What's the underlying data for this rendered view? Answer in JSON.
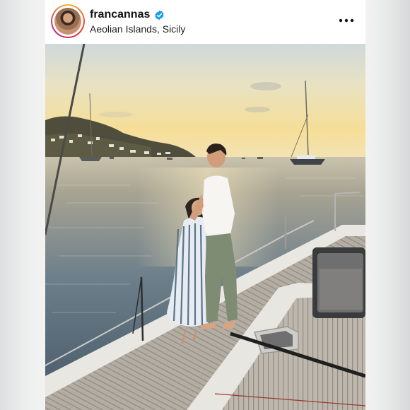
{
  "post": {
    "username": "francannas",
    "verified_icon": "verified-badge-icon",
    "location": "Aeolian Islands, Sicily",
    "more_icon": "more-options-icon",
    "avatar_icon": "profile-avatar",
    "photo_icon": "sunset-boat-photo"
  },
  "colors": {
    "verified": "#1d9bf0",
    "sky_top": "#cfd8db",
    "sky_sunset": "#f5df97",
    "sea": "#6d7f8b",
    "deck": "#b9b3aa"
  }
}
